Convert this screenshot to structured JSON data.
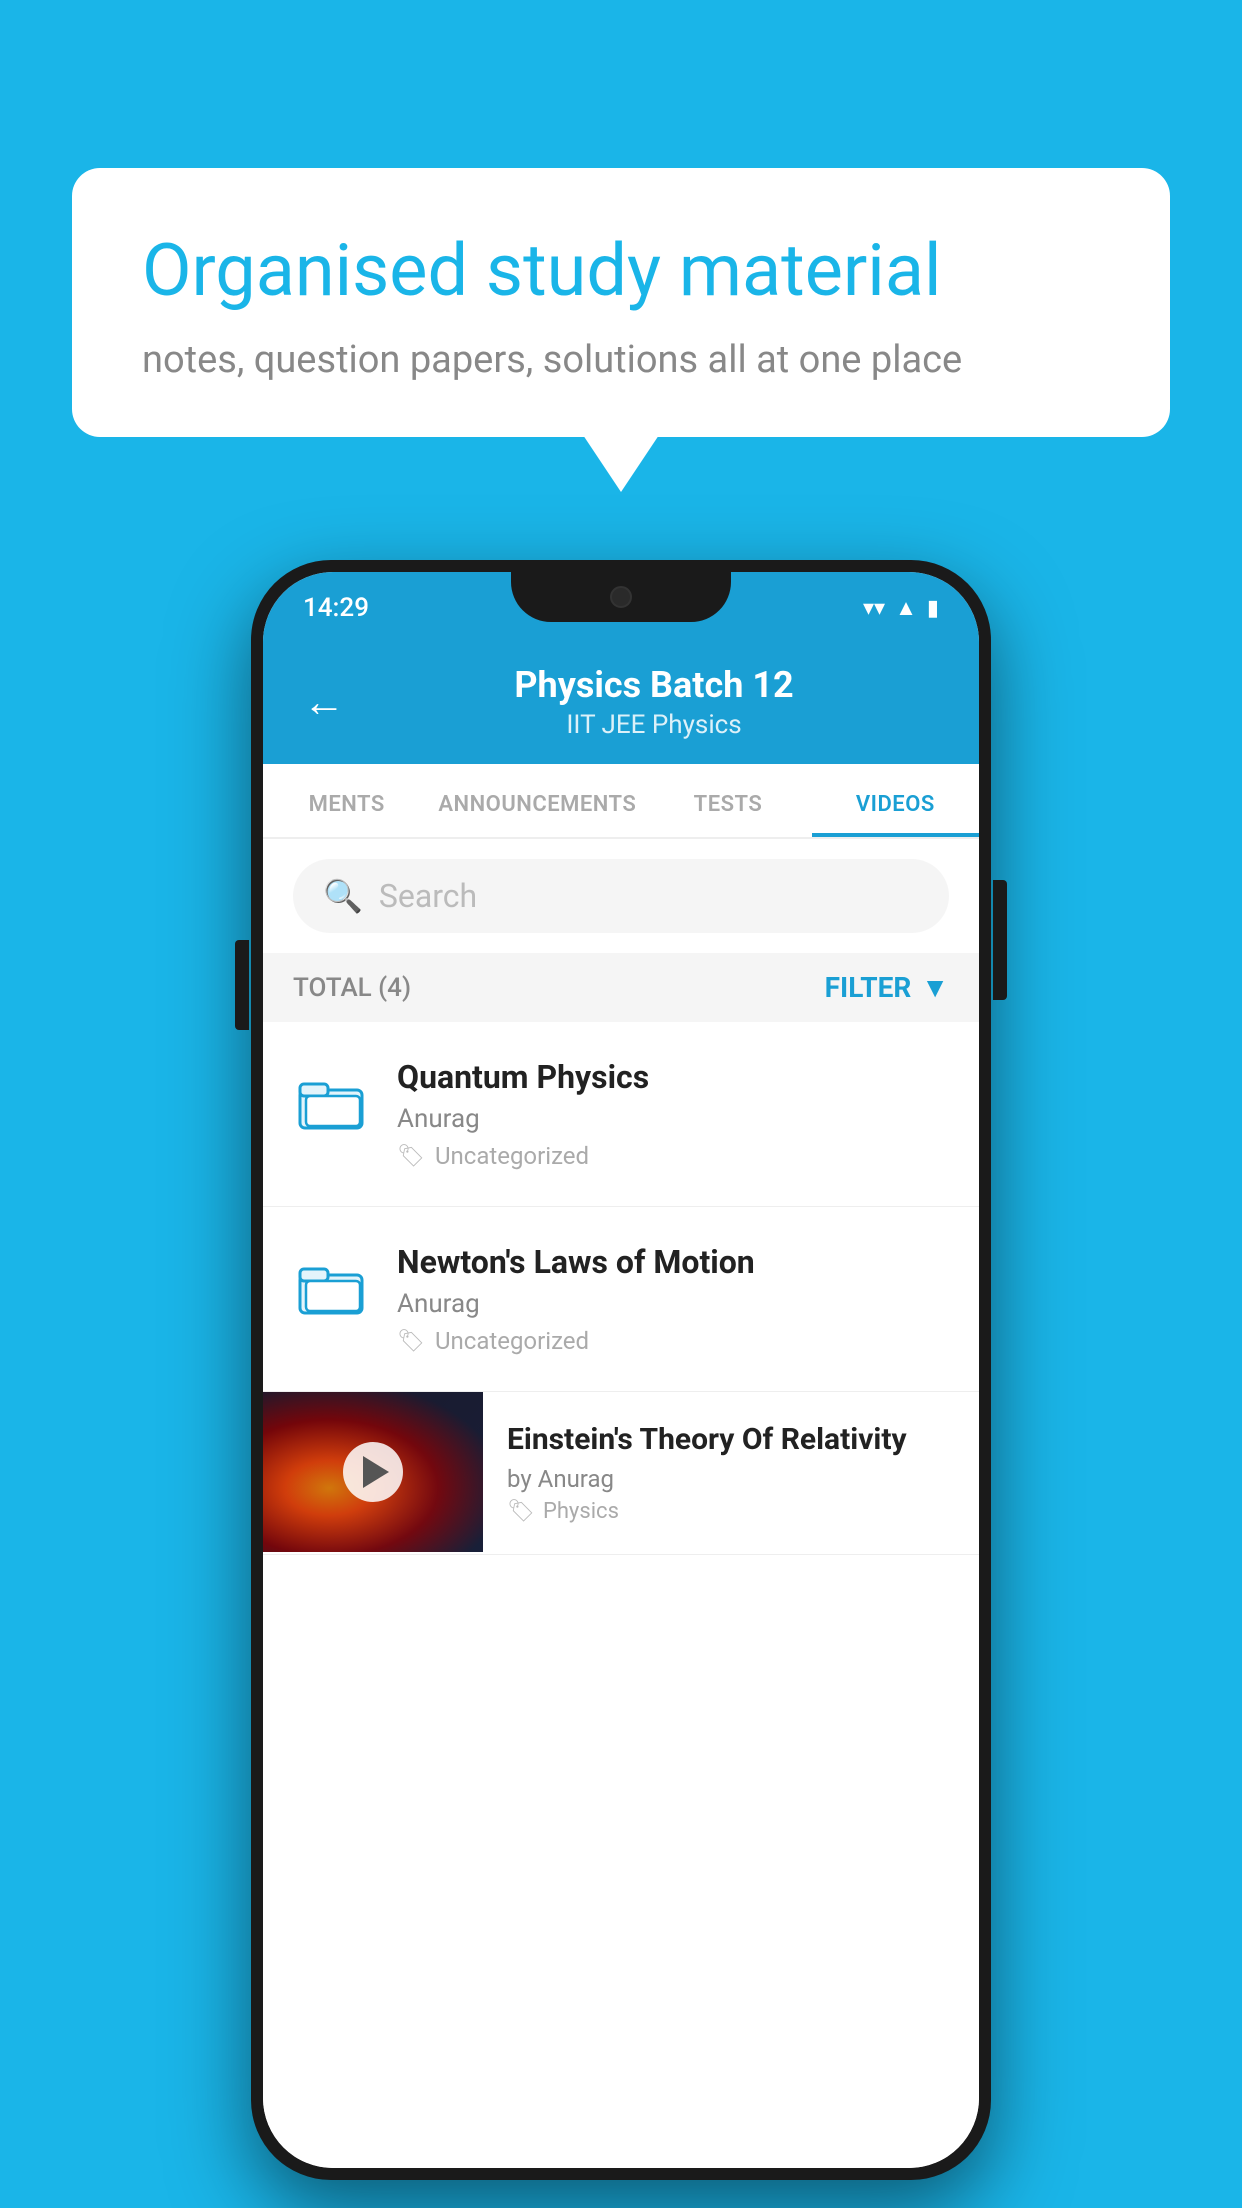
{
  "background_color": "#1ab5e8",
  "speech_bubble": {
    "title": "Organised study material",
    "subtitle": "notes, question papers, solutions all at one place"
  },
  "phone": {
    "status_bar": {
      "time": "14:29",
      "icons": [
        "wifi",
        "signal",
        "battery"
      ]
    },
    "app_header": {
      "back_label": "←",
      "title": "Physics Batch 12",
      "subtitle_tags": "IIT JEE   Physics"
    },
    "tabs": [
      {
        "label": "MENTS",
        "active": false
      },
      {
        "label": "ANNOUNCEMENTS",
        "active": false
      },
      {
        "label": "TESTS",
        "active": false
      },
      {
        "label": "VIDEOS",
        "active": true
      }
    ],
    "search": {
      "placeholder": "Search"
    },
    "filter_row": {
      "total_label": "TOTAL (4)",
      "filter_label": "FILTER"
    },
    "list_items": [
      {
        "type": "folder",
        "title": "Quantum Physics",
        "author": "Anurag",
        "tag": "Uncategorized"
      },
      {
        "type": "folder",
        "title": "Newton's Laws of Motion",
        "author": "Anurag",
        "tag": "Uncategorized"
      },
      {
        "type": "video",
        "title": "Einstein's Theory Of Relativity",
        "author": "by Anurag",
        "tag": "Physics"
      }
    ]
  }
}
